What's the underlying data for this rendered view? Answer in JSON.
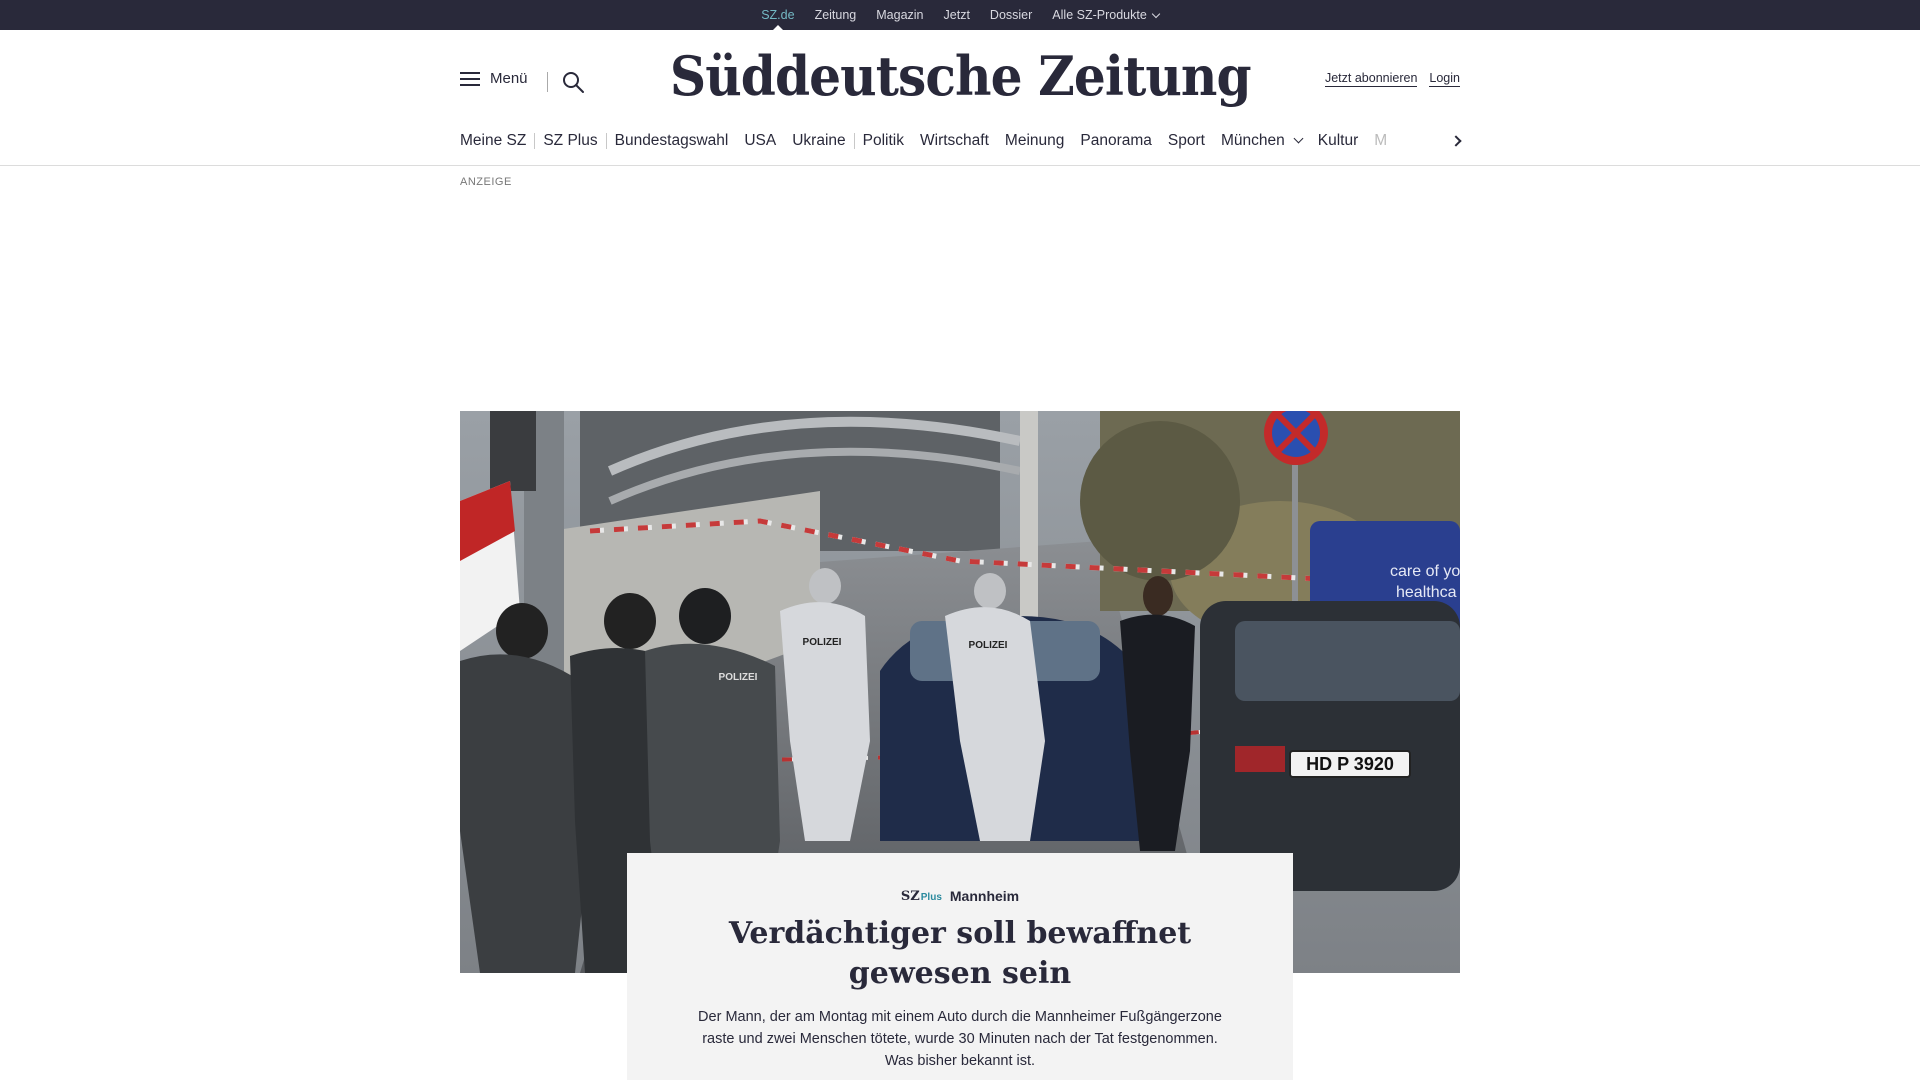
{
  "topbar": {
    "items": [
      "SZ.de",
      "Zeitung",
      "Magazin",
      "Jetzt",
      "Dossier"
    ],
    "dropdown_label": "Alle SZ-Produkte"
  },
  "header": {
    "menu_label": "Menü",
    "logo_text": "Süddeutsche Zeitung",
    "subscribe_label": "Jetzt abonnieren",
    "login_label": "Login"
  },
  "nav": {
    "items": [
      "Meine SZ",
      "SZ Plus",
      "Bundestagswahl",
      "USA",
      "Ukraine",
      "Politik",
      "Wirtschaft",
      "Meinung",
      "Panorama",
      "Sport",
      "München",
      "Kultur",
      "M"
    ]
  },
  "ad_label": "ANZEIGE",
  "teaser": {
    "badge": "SZ",
    "badge_plus": "Plus",
    "kicker": "Mannheim",
    "headline": "Verdächtiger soll bewaffnet gewesen sein",
    "summary": "Der Mann, der am Montag mit einem Auto durch die Mannheimer Fußgängerzone raste und zwei Menschen tötete, wurde 30 Minuten nach der Tat festgenommen. Was bisher bekannt ist."
  },
  "hero_image": {
    "vest_label": "POLIZEI",
    "license_plate": "HD P 3920",
    "van_text_1": "care of yo",
    "van_text_2": "healthca"
  },
  "colors": {
    "topbar_bg": "#29293a",
    "accent": "#74b9c4",
    "text": "#29293a",
    "teaser_bg": "#f3f3f3"
  }
}
